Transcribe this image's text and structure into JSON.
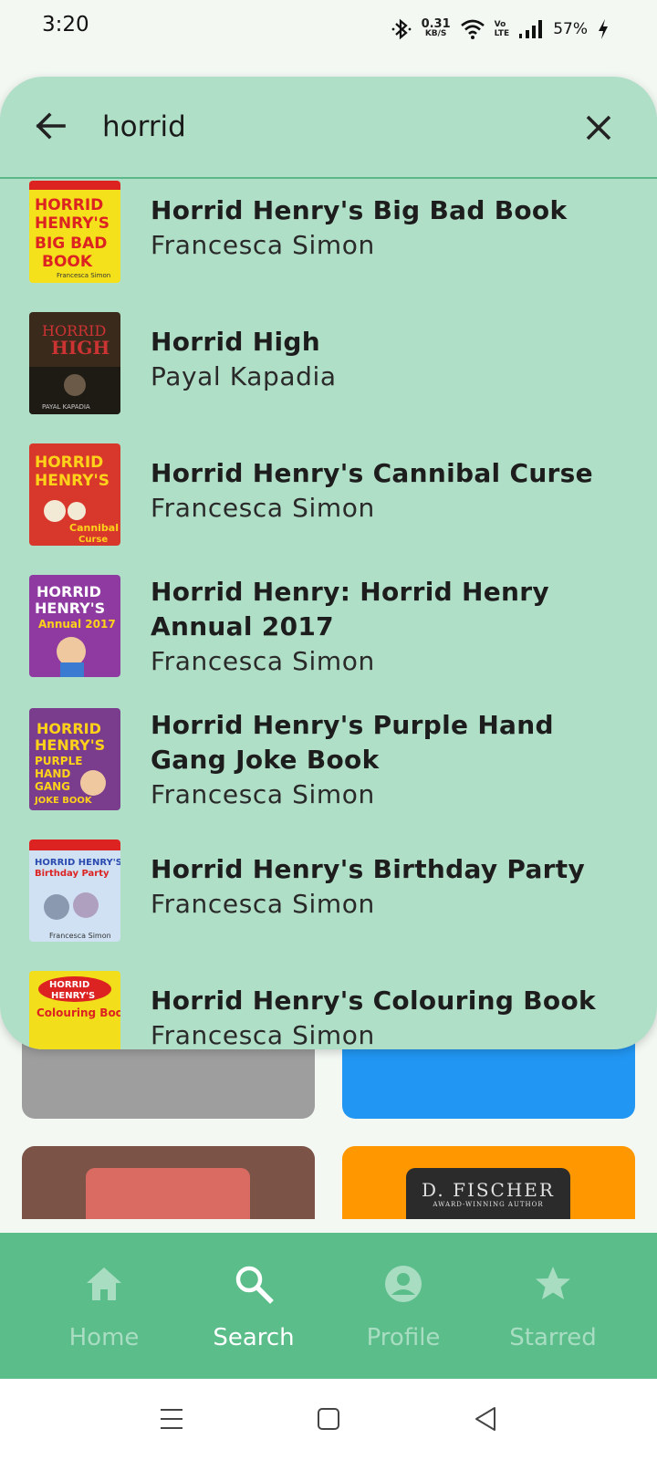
{
  "status_bar": {
    "time": "3:20",
    "net_speed_value": "0.31",
    "net_speed_unit": "KB/S",
    "volte_top": "Vo",
    "volte_bottom": "LTE",
    "battery": "57%"
  },
  "search": {
    "query": "horrid"
  },
  "results": [
    {
      "title": "Horrid Henry's Big Bad Book",
      "author": "Francesca Simon",
      "cover_color": "#f5e11b"
    },
    {
      "title": "Horrid High",
      "author": "Payal Kapadia",
      "cover_color": "#3a2a1c"
    },
    {
      "title": "Horrid Henry's Cannibal Curse",
      "author": "Francesca Simon",
      "cover_color": "#d8382c"
    },
    {
      "title": "Horrid Henry: Horrid Henry Annual 2017",
      "author": "Francesca Simon",
      "cover_color": "#8e3aa0"
    },
    {
      "title": "Horrid Henry's Purple Hand Gang Joke Book",
      "author": "Francesca Simon",
      "cover_color": "#7a3c8c"
    },
    {
      "title": "Horrid Henry's Birthday Party",
      "author": "Francesca Simon",
      "cover_color": "#cfe1f3"
    },
    {
      "title": "Horrid Henry's Colouring Book",
      "author": "Francesca Simon",
      "cover_color": "#f2de1a"
    }
  ],
  "background_cards": {
    "card4_cover_text": "D. FISCHER",
    "card4_cover_subtext": "AWARD-WINNING AUTHOR"
  },
  "bottom_nav": {
    "items": [
      {
        "label": "Home",
        "icon": "home-icon"
      },
      {
        "label": "Search",
        "icon": "search-icon"
      },
      {
        "label": "Profile",
        "icon": "profile-icon"
      },
      {
        "label": "Starred",
        "icon": "star-icon"
      }
    ],
    "active": "Search"
  },
  "colors": {
    "panel": "#b0dfc7",
    "nav": "#5bbd8a",
    "accent_line": "#5cb88a"
  }
}
